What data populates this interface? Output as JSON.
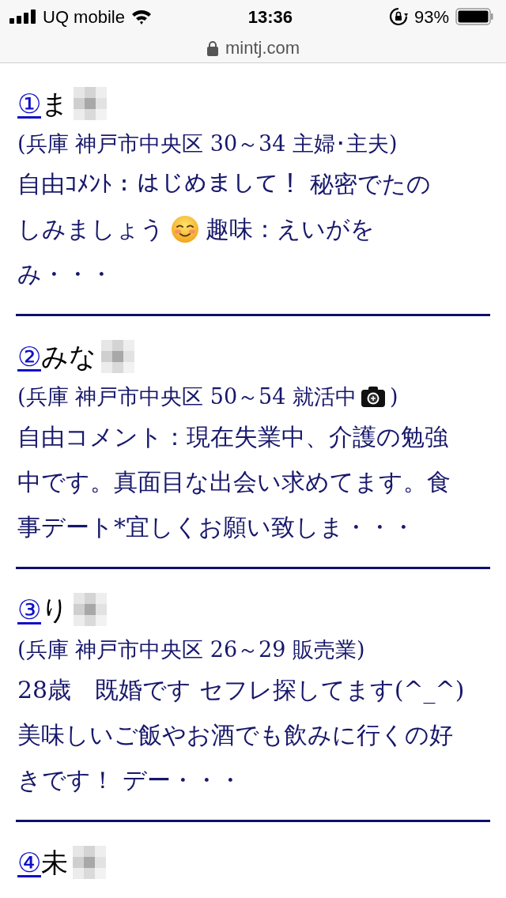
{
  "status_bar": {
    "carrier": "UQ mobile",
    "time": "13:36",
    "battery": "93%"
  },
  "address_bar": {
    "url": "mintj.com"
  },
  "entries": [
    {
      "number": "①",
      "name": "ま",
      "profile": [
        {
          "kind": "text",
          "text": "(兵庫 神戸市中央区 30～34 主婦･主夫)"
        }
      ],
      "comment": [
        [
          {
            "kind": "text",
            "text": "自由ｺﾒﾝﾄ：はじめまして！ 秘密でたの"
          }
        ],
        [
          {
            "kind": "text",
            "text": "しみましょう"
          },
          {
            "kind": "emoji"
          },
          {
            "kind": "text",
            "text": "趣味：えいがを"
          }
        ],
        [
          {
            "kind": "text",
            "text": "み・・・"
          }
        ]
      ]
    },
    {
      "number": "②",
      "name": "みな",
      "profile": [
        {
          "kind": "text",
          "text": "(兵庫 神戸市中央区 50～54 就活中"
        },
        {
          "kind": "camera"
        },
        {
          "kind": "text",
          "text": ")"
        }
      ],
      "comment": [
        [
          {
            "kind": "text",
            "text": "自由コメント：現在失業中、介護の勉強"
          }
        ],
        [
          {
            "kind": "text",
            "text": "中です。真面目な出会い求めてます。食"
          }
        ],
        [
          {
            "kind": "text",
            "text": "事デート*宜しくお願い致しま・・・"
          }
        ]
      ]
    },
    {
      "number": "③",
      "name": "り",
      "profile": [
        {
          "kind": "text",
          "text": "(兵庫 神戸市中央区 26～29 販売業)"
        }
      ],
      "comment": [
        [
          {
            "kind": "text",
            "text": "28歳　既婚です セフレ探してます(^_^)"
          }
        ],
        [
          {
            "kind": "text",
            "text": "美味しいご飯やお酒でも飲みに行くの好"
          }
        ],
        [
          {
            "kind": "text",
            "text": "きです！ デー・・・"
          }
        ]
      ]
    },
    {
      "number": "④",
      "name": "未"
    }
  ]
}
